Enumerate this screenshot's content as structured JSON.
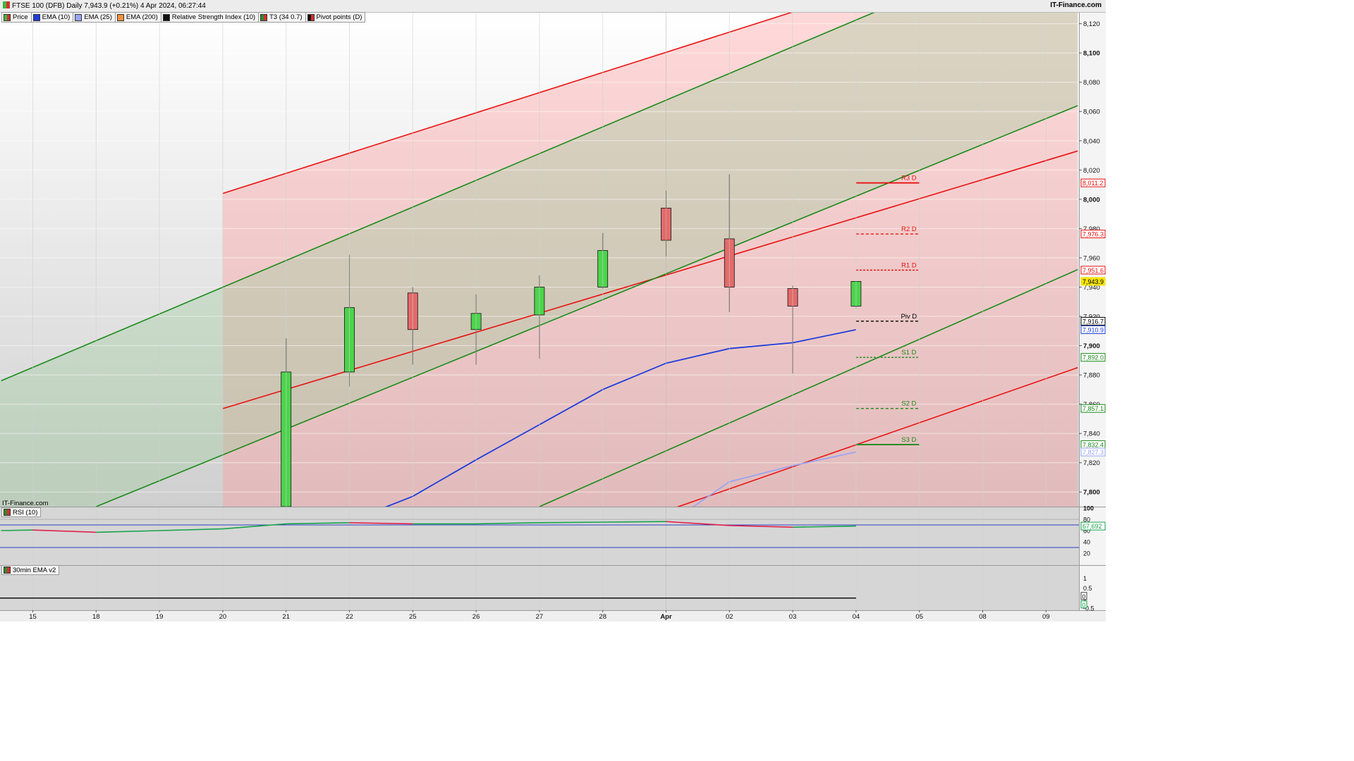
{
  "header": {
    "title": "FTSE 100 (DFB) Daily 7,943.9 (+0.21%) 4 Apr 2024, 06:27:44",
    "brand": "IT-Finance.com",
    "watermark": "IT-Finance.com"
  },
  "legend": [
    {
      "label": "Price",
      "color": "#3cb83c",
      "icon": "price-candle-icon"
    },
    {
      "label": "EMA (10)",
      "color": "#1e3ddb"
    },
    {
      "label": "EMA (25)",
      "color": "#9aa4f2"
    },
    {
      "label": "EMA (200)",
      "color": "#f5923e"
    },
    {
      "label": "Relative Strength Index (10)",
      "color": "#111111"
    },
    {
      "label": "T3 (34 0.7)",
      "color": "#2e8b2e"
    },
    {
      "label": "Pivot points (D)",
      "color": "#111111"
    }
  ],
  "panels": {
    "rsi_label": "RSI (10)",
    "ema_label": "30min EMA v2"
  },
  "colors": {
    "bull": "#4cd44c",
    "bear": "#e46a6a",
    "red_channel": "#e81010",
    "green_channel": "#1a8a1a",
    "ema10": "#1e3ddb",
    "ema25": "#9aa4f2",
    "current_price_tag": "#f5e400"
  },
  "chart_data": {
    "type": "candlestick",
    "title": "FTSE 100 (DFB) Daily",
    "x_tick_labels": [
      "15",
      "18",
      "19",
      "20",
      "21",
      "22",
      "25",
      "26",
      "27",
      "28",
      "Apr",
      "02",
      "03",
      "04",
      "05",
      "08",
      "09"
    ],
    "ylim": [
      7790,
      8128
    ],
    "y_ticks": [
      7800,
      7820,
      7840,
      7860,
      7880,
      7900,
      7920,
      7940,
      7960,
      7980,
      8000,
      8020,
      8040,
      8060,
      8080,
      8100,
      8120
    ],
    "y_tick_labels": [
      "7,800",
      "7,820",
      "7,840",
      "7,860",
      "7,880",
      "7,900",
      "7,920",
      "7,940",
      "7,960",
      "7,980",
      "8,000",
      "8,020",
      "8,040",
      "8,060",
      "8,080",
      "8,100",
      "8,120"
    ],
    "candles": [
      {
        "date": "21",
        "open": 7790,
        "high": 7905,
        "low": 7790,
        "close": 7882
      },
      {
        "date": "22",
        "open": 7882,
        "high": 7962,
        "low": 7872,
        "close": 7926
      },
      {
        "date": "25",
        "open": 7936,
        "high": 7940,
        "low": 7887,
        "close": 7911
      },
      {
        "date": "26",
        "open": 7911,
        "high": 7935,
        "low": 7887,
        "close": 7922
      },
      {
        "date": "27",
        "open": 7921,
        "high": 7948,
        "low": 7891,
        "close": 7940
      },
      {
        "date": "28",
        "open": 7940,
        "high": 7977,
        "low": 7939,
        "close": 7965
      },
      {
        "date": "Apr",
        "open": 7994,
        "high": 8006,
        "low": 7961,
        "close": 7972
      },
      {
        "date": "02",
        "open": 7973,
        "high": 8017,
        "low": 7923,
        "close": 7940
      },
      {
        "date": "03",
        "open": 7939,
        "high": 7941,
        "low": 7881,
        "close": 7927
      },
      {
        "date": "04",
        "open": 7927,
        "high": 7944,
        "low": 7926,
        "close": 7943.9
      }
    ],
    "series": [
      {
        "name": "EMA (10)",
        "x": [
          "22",
          "25",
          "26",
          "27",
          "28",
          "Apr",
          "02",
          "03",
          "04"
        ],
        "values": [
          7780,
          7797,
          7822,
          7846,
          7870,
          7888,
          7898,
          7902,
          7910.9
        ]
      },
      {
        "name": "EMA (25)",
        "x": [
          "Apr",
          "02",
          "03",
          "04"
        ],
        "values": [
          7777,
          7807,
          7818,
          7827.3
        ]
      }
    ],
    "channels": [
      {
        "name": "upper-red",
        "color": "#e81010",
        "from": {
          "x": "20",
          "y": 8004
        },
        "to": {
          "x": "03",
          "y": 8128
        }
      },
      {
        "name": "middle-red",
        "color": "#e81010",
        "from": {
          "x": "20",
          "y": 7857
        },
        "to": {
          "x": "09+",
          "y": 8033
        }
      },
      {
        "name": "lower-red",
        "color": "#e81010",
        "from": {
          "x": "28",
          "y": 7772
        },
        "to": {
          "x": "09+",
          "y": 7885
        }
      },
      {
        "name": "upper-green",
        "color": "#1a8a1a",
        "from": {
          "x": "15-",
          "y": 7876
        },
        "to": {
          "x": "03+",
          "y": 8128
        }
      },
      {
        "name": "middle-green",
        "color": "#1a8a1a",
        "from": {
          "x": "18",
          "y": 7790
        },
        "to": {
          "x": "09+",
          "y": 8064
        }
      },
      {
        "name": "lower-green",
        "color": "#1a8a1a",
        "from": {
          "x": "27",
          "y": 7790
        },
        "to": {
          "x": "09+",
          "y": 7952
        }
      }
    ],
    "pivots": [
      {
        "label": "R3 D",
        "value": 8011.2,
        "value_label": "8,011.2",
        "style": "solid",
        "color": "#e81010"
      },
      {
        "label": "R2 D",
        "value": 7976.3,
        "value_label": "7,976.3",
        "style": "dashed",
        "color": "#e81010"
      },
      {
        "label": "R1 D",
        "value": 7951.6,
        "value_label": "7,951.6",
        "style": "dotted",
        "color": "#e81010"
      },
      {
        "label": "Piv D",
        "value": 7916.7,
        "value_label": "7,916.7",
        "style": "dashed",
        "color": "#000000"
      },
      {
        "label": "S1 D",
        "value": 7892.0,
        "value_label": "7,892.0",
        "style": "dotted",
        "color": "#1a8a1a"
      },
      {
        "label": "S2 D",
        "value": 7857.1,
        "value_label": "7,857.1",
        "style": "dashed",
        "color": "#1a8a1a"
      },
      {
        "label": "S3 D",
        "value": 7832.4,
        "value_label": "7,832.4",
        "style": "solid",
        "color": "#1a8a1a"
      }
    ],
    "price_tags": [
      {
        "value": 7943.9,
        "label": "7,943.9",
        "color": "#f5e400"
      },
      {
        "value": 7910.9,
        "label": "7,910.9",
        "color": "#1e3ddb"
      },
      {
        "value": 7827.3,
        "label": "7,827.3",
        "color": "#9aa4f2"
      }
    ],
    "rsi": {
      "ylim": [
        0,
        100
      ],
      "y_ticks": [
        20,
        40,
        60,
        80,
        100
      ],
      "y_tick_labels": [
        "20",
        "40",
        "60",
        "80",
        "100"
      ],
      "overbought": 70,
      "oversold": 30,
      "last_label": "67,692",
      "x": [
        "15-",
        "15",
        "18",
        "19",
        "20",
        "21",
        "22",
        "25",
        "26",
        "27",
        "28",
        "Apr",
        "02",
        "03",
        "04"
      ],
      "values": [
        60,
        61,
        57,
        60,
        63,
        72,
        74,
        72,
        72,
        74,
        75,
        76,
        69,
        66,
        68
      ]
    },
    "ema_panel": {
      "ylim": [
        -0.5,
        1.5
      ],
      "y_ticks": [
        1,
        0.5,
        0,
        -0.5
      ],
      "y_tick_labels": [
        "1",
        "0.5",
        "0",
        "-0.5"
      ],
      "zero_tags": [
        "0",
        "0"
      ],
      "value": 0
    }
  }
}
